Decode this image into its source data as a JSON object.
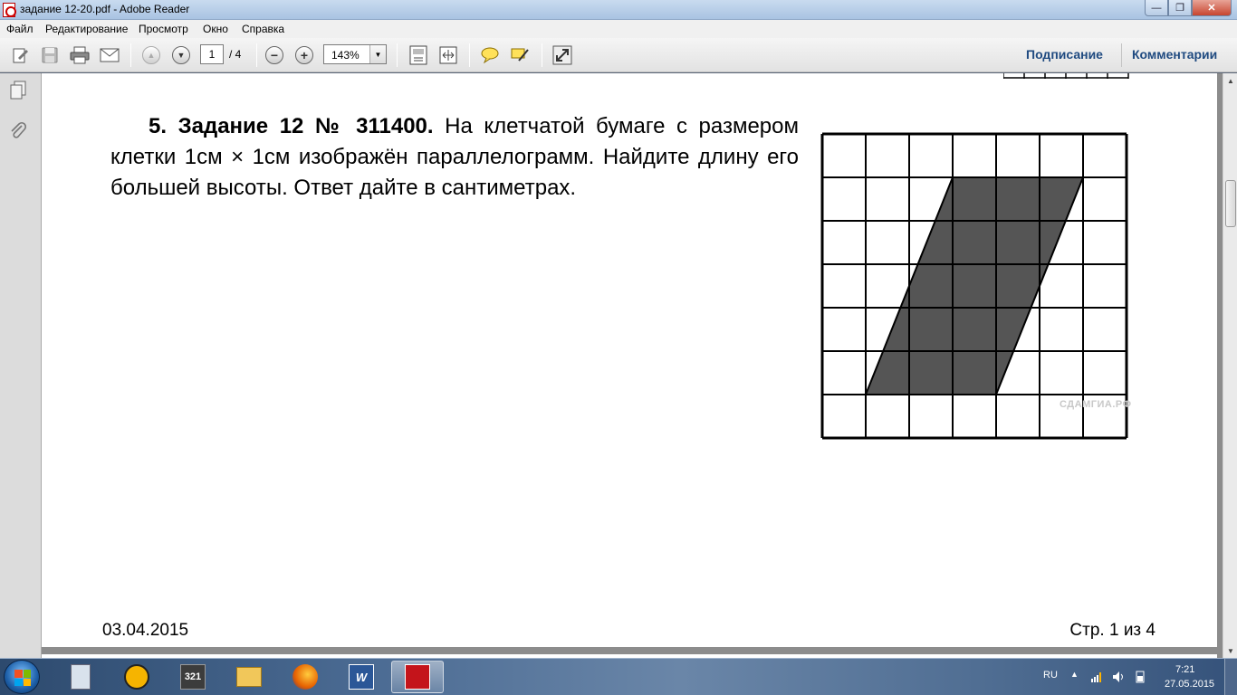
{
  "window": {
    "title": "задание 12-20.pdf - Adobe Reader",
    "minimize_glyph": "—",
    "maximize_glyph": "❐",
    "close_glyph": "✕"
  },
  "menu": [
    "Файл",
    "Редактирование",
    "Просмотр",
    "Окно",
    "Справка"
  ],
  "toolbar": {
    "page_current": "1",
    "page_total": "/ 4",
    "zoom": "143%",
    "sign_label": "Подписание",
    "comment_label": "Комментарии",
    "zoom_out_glyph": "−",
    "zoom_in_glyph": "+",
    "prev_page_glyph": "▲",
    "next_page_glyph": "▼",
    "dropdown_glyph": "▼"
  },
  "document": {
    "problem_number": "5. Задание 12 № 311400.",
    "problem_text": " На клетчатой бумаге с размером клетки 1см × 1см изображён параллелограмм. Найдите длину его большей высоты. Ответ дайте в сантиметрах.",
    "watermark": "СДАМГИА.РФ",
    "footer_date": "03.04.2015",
    "footer_page": "Стр. 1 из 4"
  },
  "figure": {
    "grid_cols": 7,
    "grid_rows": 7,
    "parallelogram": [
      [
        3,
        1
      ],
      [
        6,
        1
      ],
      [
        4,
        6
      ],
      [
        1,
        6
      ]
    ],
    "fill_color": "#555555"
  },
  "scrollbar": {
    "up_glyph": "▲",
    "down_glyph": "▼"
  },
  "taskbar": {
    "lang": "RU",
    "tray_up_glyph": "▲",
    "time": "7:21",
    "date": "27.05.2015",
    "apps": [
      "calculator-icon",
      "aimp-icon",
      "media-player-classic-icon",
      "file-explorer-icon",
      "firefox-icon",
      "word-icon",
      "adobe-reader-icon"
    ]
  }
}
